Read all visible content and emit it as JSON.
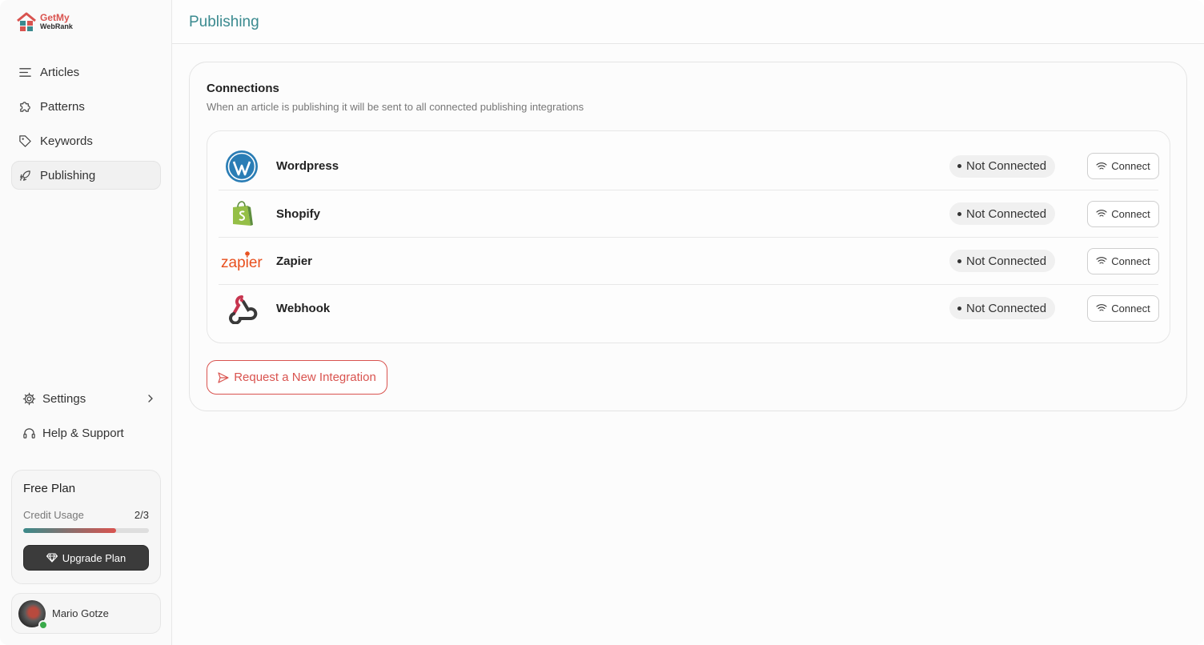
{
  "brand": {
    "line1": "GetMy",
    "line2": "WebRank",
    "primary_color": "#d9534f",
    "accent_color": "#3a8a8f"
  },
  "sidebar": {
    "items": [
      {
        "label": "Articles",
        "icon": "list-icon"
      },
      {
        "label": "Patterns",
        "icon": "puzzle-icon"
      },
      {
        "label": "Keywords",
        "icon": "tag-icon"
      },
      {
        "label": "Publishing",
        "icon": "rocket-icon",
        "active": true
      }
    ],
    "bottom": [
      {
        "label": "Settings",
        "icon": "gear-icon"
      },
      {
        "label": "Help & Support",
        "icon": "headset-icon"
      }
    ]
  },
  "plan": {
    "name": "Free Plan",
    "credit_label": "Credit Usage",
    "credit_value": "2/3",
    "credit_used_fraction": 0.74,
    "upgrade_label": "Upgrade Plan"
  },
  "user": {
    "name": "Mario Gotze",
    "status": "online"
  },
  "header": {
    "title": "Publishing"
  },
  "connections": {
    "title": "Connections",
    "subtitle": "When an article is publishing it will be sent to all connected publishing integrations",
    "items": [
      {
        "name": "Wordpress",
        "logo": "wordpress-logo",
        "status": "Not Connected",
        "action": "Connect"
      },
      {
        "name": "Shopify",
        "logo": "shopify-logo",
        "status": "Not Connected",
        "action": "Connect"
      },
      {
        "name": "Zapier",
        "logo": "zapier-logo",
        "logo_text": "zapier",
        "status": "Not Connected",
        "action": "Connect"
      },
      {
        "name": "Webhook",
        "logo": "webhook-logo",
        "status": "Not Connected",
        "action": "Connect"
      }
    ],
    "request_label": "Request a New Integration"
  }
}
